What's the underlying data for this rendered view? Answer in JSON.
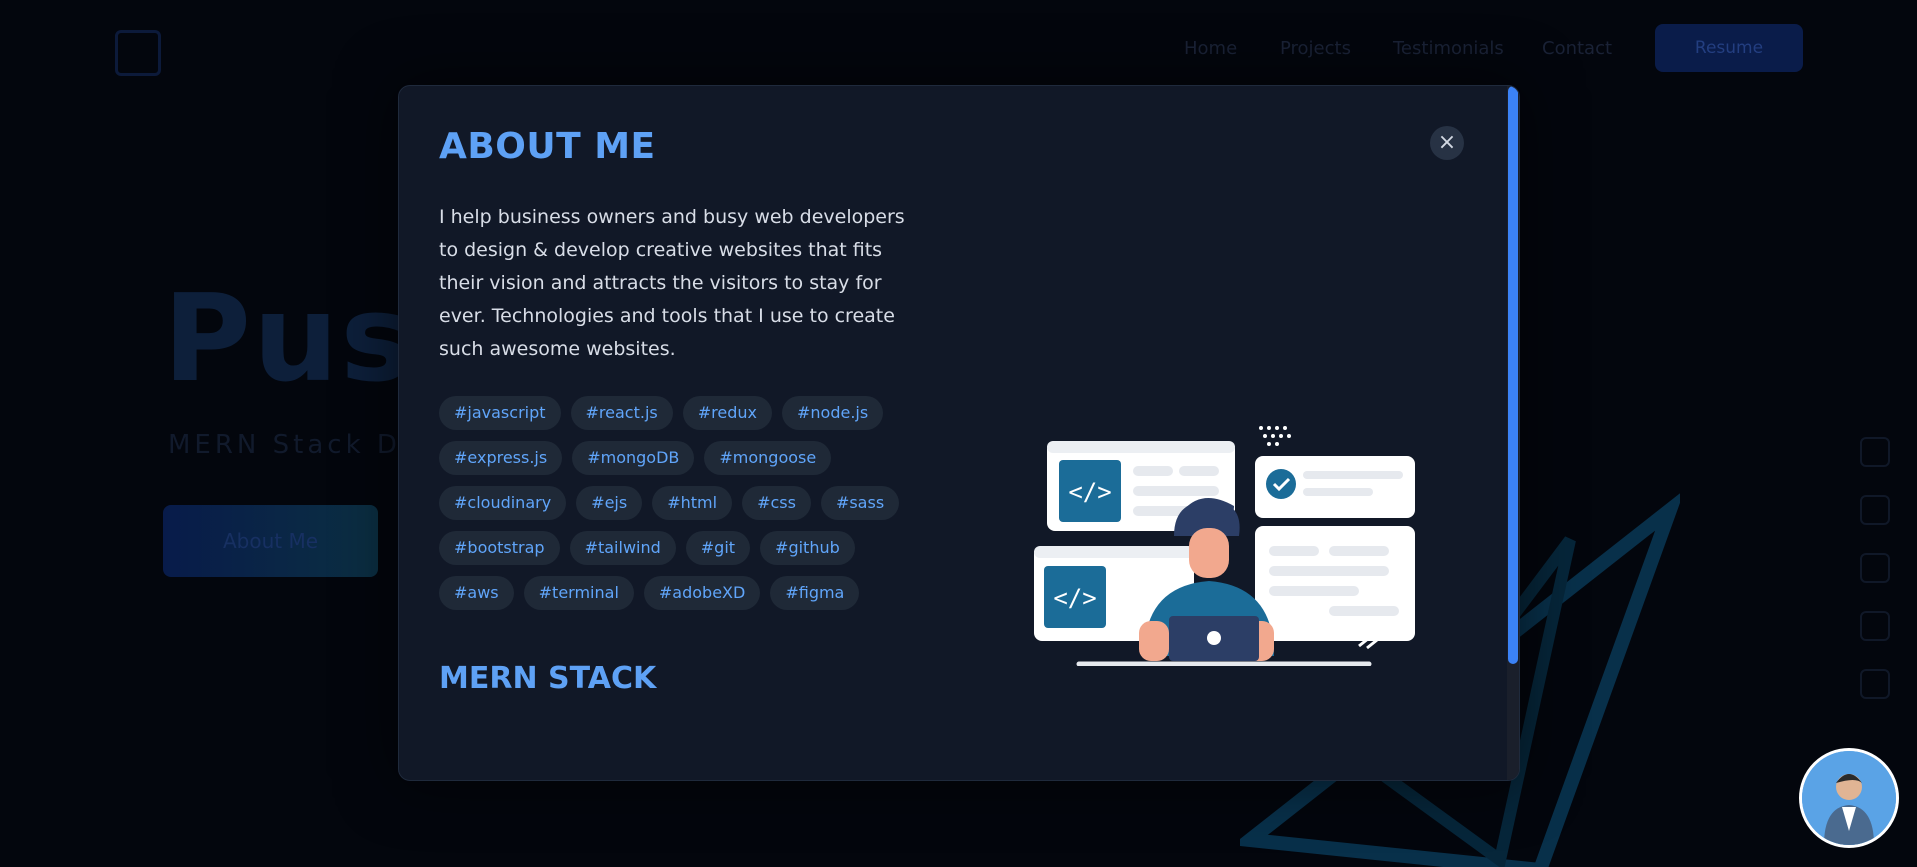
{
  "nav": {
    "links": [
      "Home",
      "Projects",
      "Testimonials",
      "Contact"
    ],
    "button_label": "Resume"
  },
  "hero": {
    "title": "Push",
    "subtitle": "MERN Stack De",
    "button_label": "About Me"
  },
  "modal": {
    "title": "ABOUT ME",
    "description": "I help business owners and busy web developers to design & develop creative websites that fits their vision and attracts the visitors to stay for ever. Technologies and tools that I use to create such awesome websites.",
    "tag_rows": [
      [
        "#javascript",
        "#react.js",
        "#redux",
        "#node.js"
      ],
      [
        "#express.js",
        "#mongoDB",
        "#mongoose"
      ],
      [
        "#cloudinary",
        "#ejs",
        "#html",
        "#css",
        "#sass"
      ],
      [
        "#bootstrap",
        "#tailwind",
        "#git",
        "#github"
      ],
      [
        "#aws",
        "#terminal",
        "#adobeXD",
        "#figma"
      ]
    ],
    "section_title": "MERN STACK",
    "close_icon": "×"
  },
  "colors": {
    "accent": "#5ea1f5",
    "tag_bg": "#1f2937",
    "modal_bg": "#111827",
    "scroll_thumb": "#3b82f6"
  }
}
